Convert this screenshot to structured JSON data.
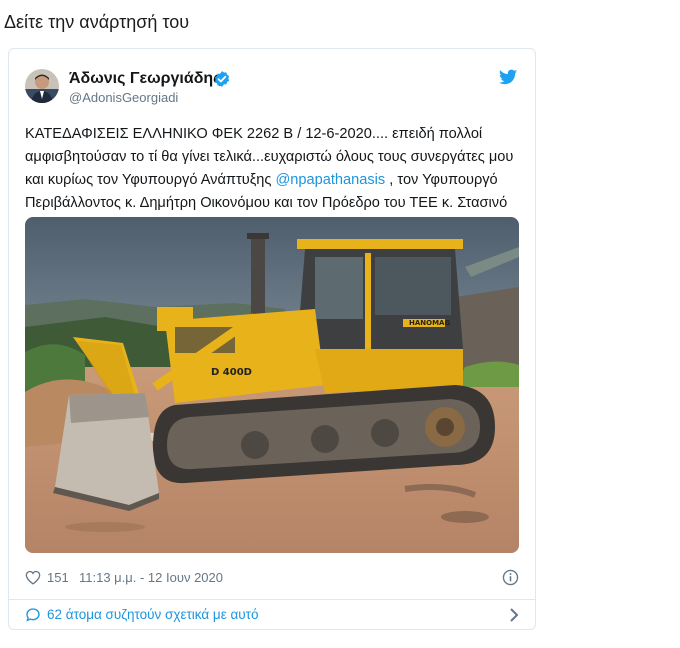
{
  "page": {
    "heading": "Δείτε την ανάρτησή του"
  },
  "tweet": {
    "author_name": "Άδωνις Γεωργιάδης",
    "author_handle": "@AdonisGeorgiadi",
    "text_part1": "ΚΑΤΕΔΑΦΙΣΕΙΣ ΕΛΛΗΝΙΚΟ ΦΕΚ 2262 Β / 12-6-2020.... επειδή πολλοί αμφισβητούσαν το τί θα γίνει τελικά...ευχαριστώ όλους τους συνεργάτες μου και κυρίως τον Υφυπουργό Ανάπτυξης ",
    "mention": "@npapathanasis",
    "text_part2": " , τον Υφυπουργό Περιβάλλοντος κ. Δημήτρη Οικονόμου και τον Πρόεδρο του ΤΕΕ κ. Στασινό",
    "photo": {
      "bulldozer_brand": "HANOMAG",
      "model_label": "D 400D"
    },
    "like_count": "151",
    "timestamp": "11:13 μ.μ. - 12 Ιουν 2020",
    "conversation_text": "62 άτομα συζητούν σχετικά με αυτό"
  },
  "colors": {
    "link": "#1b95e0",
    "secondary_text": "#657786",
    "border": "#e1e8ed",
    "bulldozer_yellow": "#e7b21a"
  },
  "icons": {
    "verified": "verified-badge-icon",
    "brand": "twitter-bird-icon",
    "like": "heart-icon",
    "info": "info-icon",
    "conversation": "speech-bubble-icon",
    "chevron": "chevron-right-icon"
  }
}
